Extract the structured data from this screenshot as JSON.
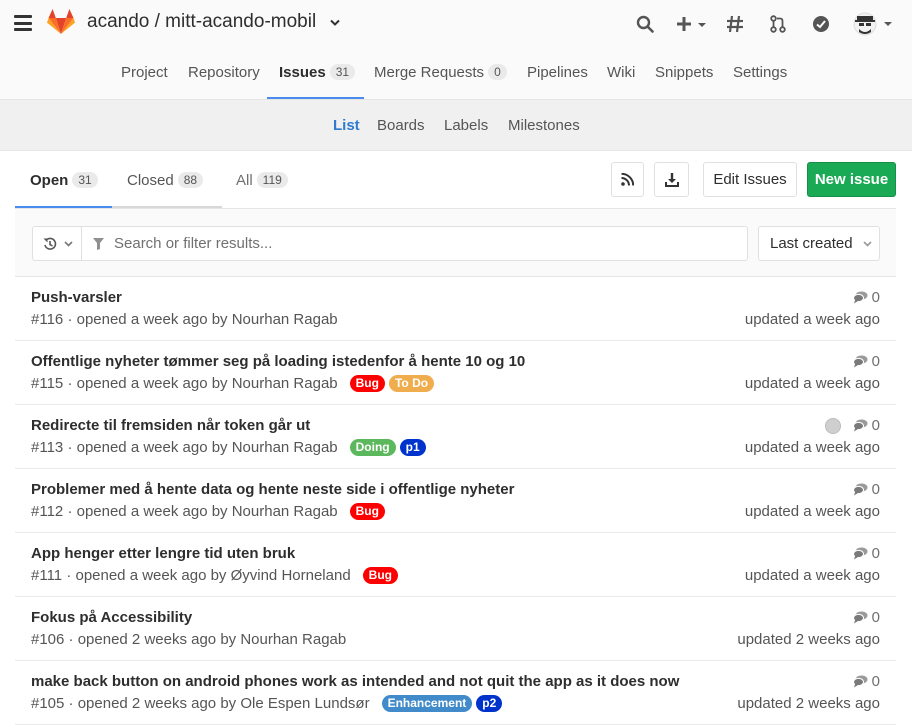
{
  "header": {
    "project_title": "acando / mitt-acando-mobil"
  },
  "nav": {
    "items": [
      {
        "label": "Project"
      },
      {
        "label": "Repository"
      },
      {
        "label": "Issues",
        "count": "31"
      },
      {
        "label": "Merge Requests",
        "count": "0"
      },
      {
        "label": "Pipelines"
      },
      {
        "label": "Wiki"
      },
      {
        "label": "Snippets"
      },
      {
        "label": "Settings"
      }
    ],
    "active": "Issues"
  },
  "subnav": {
    "items": [
      {
        "label": "List"
      },
      {
        "label": "Boards"
      },
      {
        "label": "Labels"
      },
      {
        "label": "Milestones"
      }
    ],
    "active": "List"
  },
  "state_tabs": [
    {
      "label": "Open",
      "count": "31"
    },
    {
      "label": "Closed",
      "count": "88"
    },
    {
      "label": "All",
      "count": "119"
    }
  ],
  "actions": {
    "edit_issues": "Edit Issues",
    "new_issue": "New issue"
  },
  "filter": {
    "placeholder": "Search or filter results...",
    "sort": "Last created"
  },
  "colors": {
    "accent": "#4a8bee",
    "green": "#1aaa55",
    "label_bug": "#ff0000",
    "label_todo": "#f0ad4e",
    "label_doing": "#5cb85c",
    "label_p1": "#0033cc",
    "label_enhancement": "#428bca",
    "label_p2": "#0033cc"
  },
  "issues": [
    {
      "title": "Push-varsler",
      "ref": "#116",
      "meta": "· opened a week ago by Nourhan Ragab",
      "labels": [],
      "comments": "0",
      "updated": "updated a week ago"
    },
    {
      "title": "Offentlige nyheter tømmer seg på loading istedenfor å hente 10 og 10",
      "ref": "#115",
      "meta": "· opened a week ago by Nourhan Ragab",
      "labels": [
        {
          "text": "Bug",
          "color": "#ff0000"
        },
        {
          "text": "To Do",
          "color": "#f0ad4e"
        }
      ],
      "comments": "0",
      "updated": "updated a week ago"
    },
    {
      "title": "Redirecte til fremsiden når token går ut",
      "ref": "#113",
      "meta": "· opened a week ago by Nourhan Ragab",
      "labels": [
        {
          "text": "Doing",
          "color": "#5cb85c"
        },
        {
          "text": "p1",
          "color": "#0033cc"
        }
      ],
      "comments": "0",
      "updated": "updated a week ago",
      "assignee": true
    },
    {
      "title": "Problemer med å hente data og hente neste side i offentlige nyheter",
      "ref": "#112",
      "meta": "· opened a week ago by Nourhan Ragab",
      "labels": [
        {
          "text": "Bug",
          "color": "#ff0000"
        }
      ],
      "comments": "0",
      "updated": "updated a week ago"
    },
    {
      "title": "App henger etter lengre tid uten bruk",
      "ref": "#111",
      "meta": "· opened a week ago by Øyvind Horneland",
      "labels": [
        {
          "text": "Bug",
          "color": "#ff0000"
        }
      ],
      "comments": "0",
      "updated": "updated a week ago"
    },
    {
      "title": "Fokus på Accessibility",
      "ref": "#106",
      "meta": "· opened 2 weeks ago by Nourhan Ragab",
      "labels": [],
      "comments": "0",
      "updated": "updated 2 weeks ago"
    },
    {
      "title": "make back button on android phones work as intended and not quit the app as it does now",
      "ref": "#105",
      "meta": "· opened 2 weeks ago by Ole Espen Lundsør",
      "labels": [
        {
          "text": "Enhancement",
          "color": "#428bca"
        },
        {
          "text": "p2",
          "color": "#0033cc"
        }
      ],
      "comments": "0",
      "updated": "updated 2 weeks ago"
    }
  ]
}
